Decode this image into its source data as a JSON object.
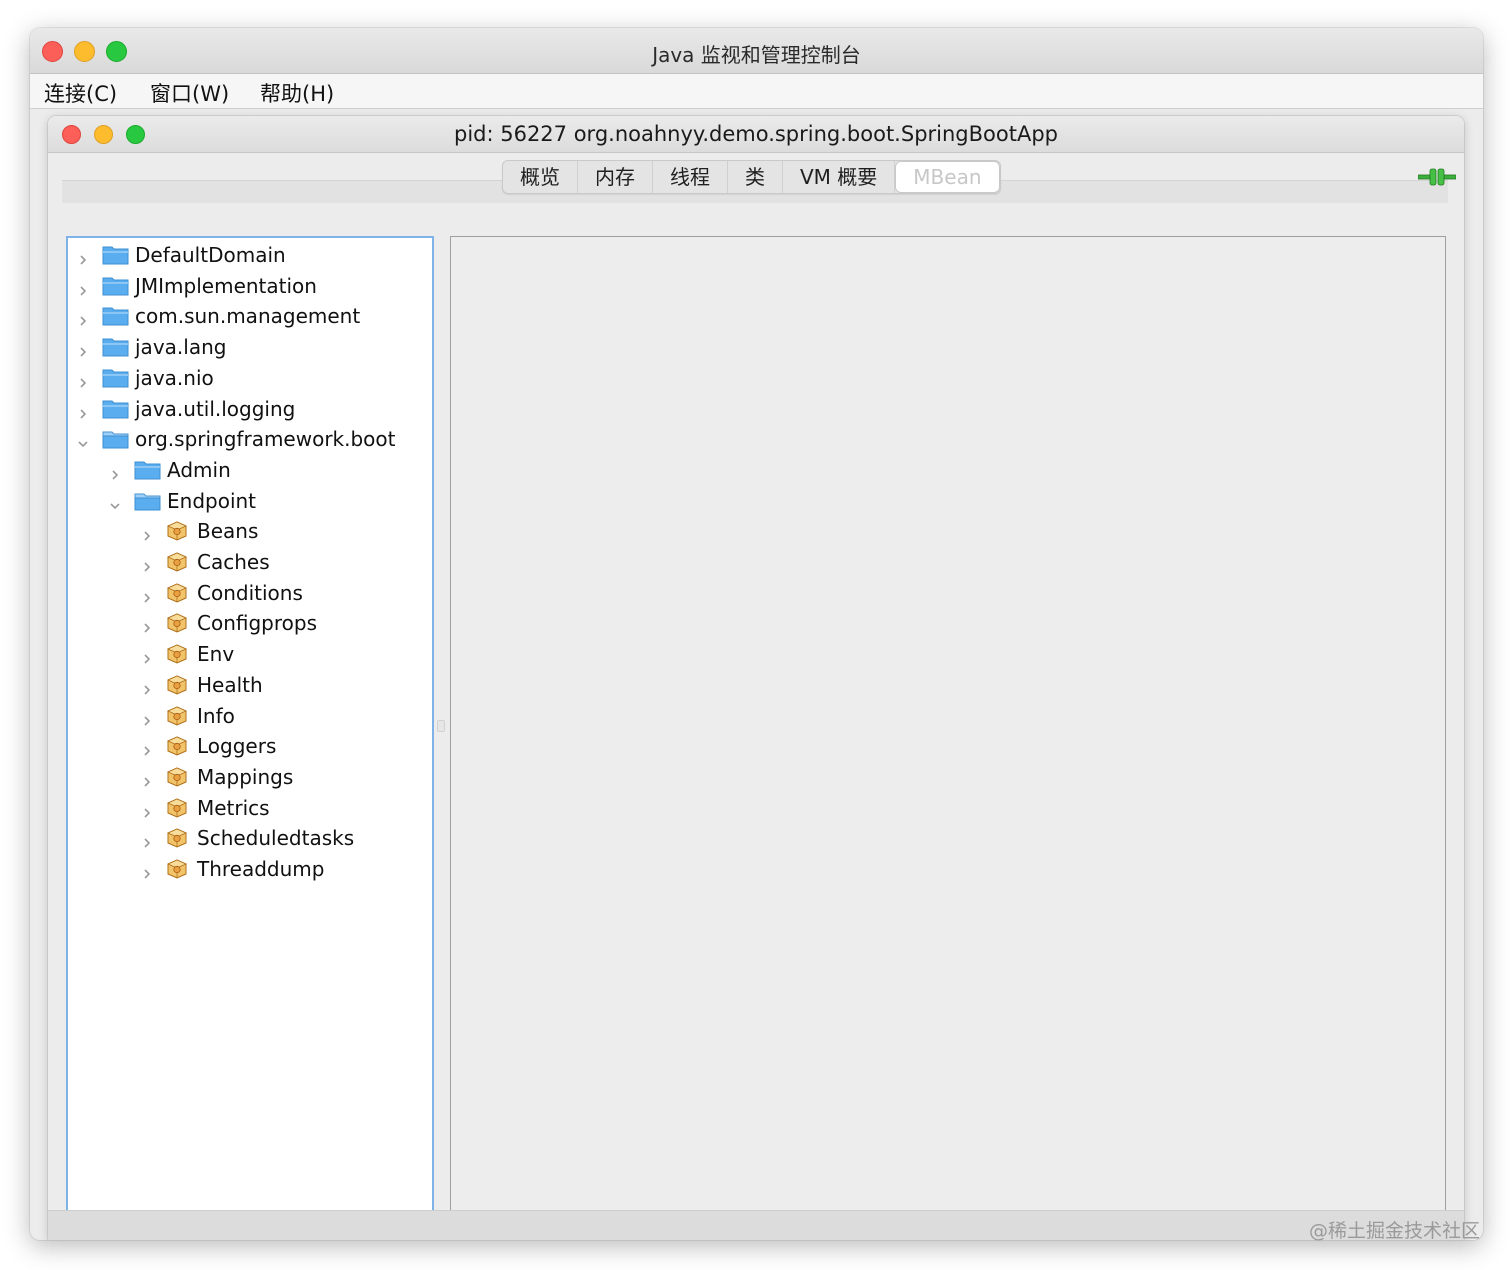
{
  "outer_window": {
    "title": "Java 监视和管理控制台",
    "menu": [
      "连接(C)",
      "窗口(W)",
      "帮助(H)"
    ]
  },
  "inner_window": {
    "title": "pid: 56227 org.noahnyy.demo.spring.boot.SpringBootApp",
    "tabs": [
      "概览",
      "内存",
      "线程",
      "类",
      "VM 概要",
      "MBean"
    ],
    "active_tab": "MBean",
    "connection_icon": "plug-connected-icon"
  },
  "tree": {
    "nodes": [
      {
        "label": "DefaultDomain",
        "level": 0,
        "icon": "folder-icon",
        "expanded": false
      },
      {
        "label": "JMImplementation",
        "level": 0,
        "icon": "folder-icon",
        "expanded": false
      },
      {
        "label": "com.sun.management",
        "level": 0,
        "icon": "folder-icon",
        "expanded": false
      },
      {
        "label": "java.lang",
        "level": 0,
        "icon": "folder-icon",
        "expanded": false
      },
      {
        "label": "java.nio",
        "level": 0,
        "icon": "folder-icon",
        "expanded": false
      },
      {
        "label": "java.util.logging",
        "level": 0,
        "icon": "folder-icon",
        "expanded": false
      },
      {
        "label": "org.springframework.boot",
        "level": 0,
        "icon": "folder-open-icon",
        "expanded": true
      },
      {
        "label": "Admin",
        "level": 1,
        "icon": "folder-icon",
        "expanded": false
      },
      {
        "label": "Endpoint",
        "level": 1,
        "icon": "folder-open-icon",
        "expanded": true
      },
      {
        "label": "Beans",
        "level": 2,
        "icon": "bean-icon",
        "expanded": false
      },
      {
        "label": "Caches",
        "level": 2,
        "icon": "bean-icon",
        "expanded": false
      },
      {
        "label": "Conditions",
        "level": 2,
        "icon": "bean-icon",
        "expanded": false
      },
      {
        "label": "Configprops",
        "level": 2,
        "icon": "bean-icon",
        "expanded": false
      },
      {
        "label": "Env",
        "level": 2,
        "icon": "bean-icon",
        "expanded": false
      },
      {
        "label": "Health",
        "level": 2,
        "icon": "bean-icon",
        "expanded": false
      },
      {
        "label": "Info",
        "level": 2,
        "icon": "bean-icon",
        "expanded": false
      },
      {
        "label": "Loggers",
        "level": 2,
        "icon": "bean-icon",
        "expanded": false
      },
      {
        "label": "Mappings",
        "level": 2,
        "icon": "bean-icon",
        "expanded": false
      },
      {
        "label": "Metrics",
        "level": 2,
        "icon": "bean-icon",
        "expanded": false
      },
      {
        "label": "Scheduledtasks",
        "level": 2,
        "icon": "bean-icon",
        "expanded": false
      },
      {
        "label": "Threaddump",
        "level": 2,
        "icon": "bean-icon",
        "expanded": false
      }
    ]
  },
  "watermark": "@稀土掘金技术社区",
  "colors": {
    "tree_border": "#7fb2e6",
    "folder_blue": "#5aaef0",
    "bean_orange": "#e8a040",
    "traffic_red": "#fc5f57",
    "traffic_yellow": "#fdbc2e",
    "traffic_green": "#28c840",
    "plug_green": "#3cae3c"
  }
}
